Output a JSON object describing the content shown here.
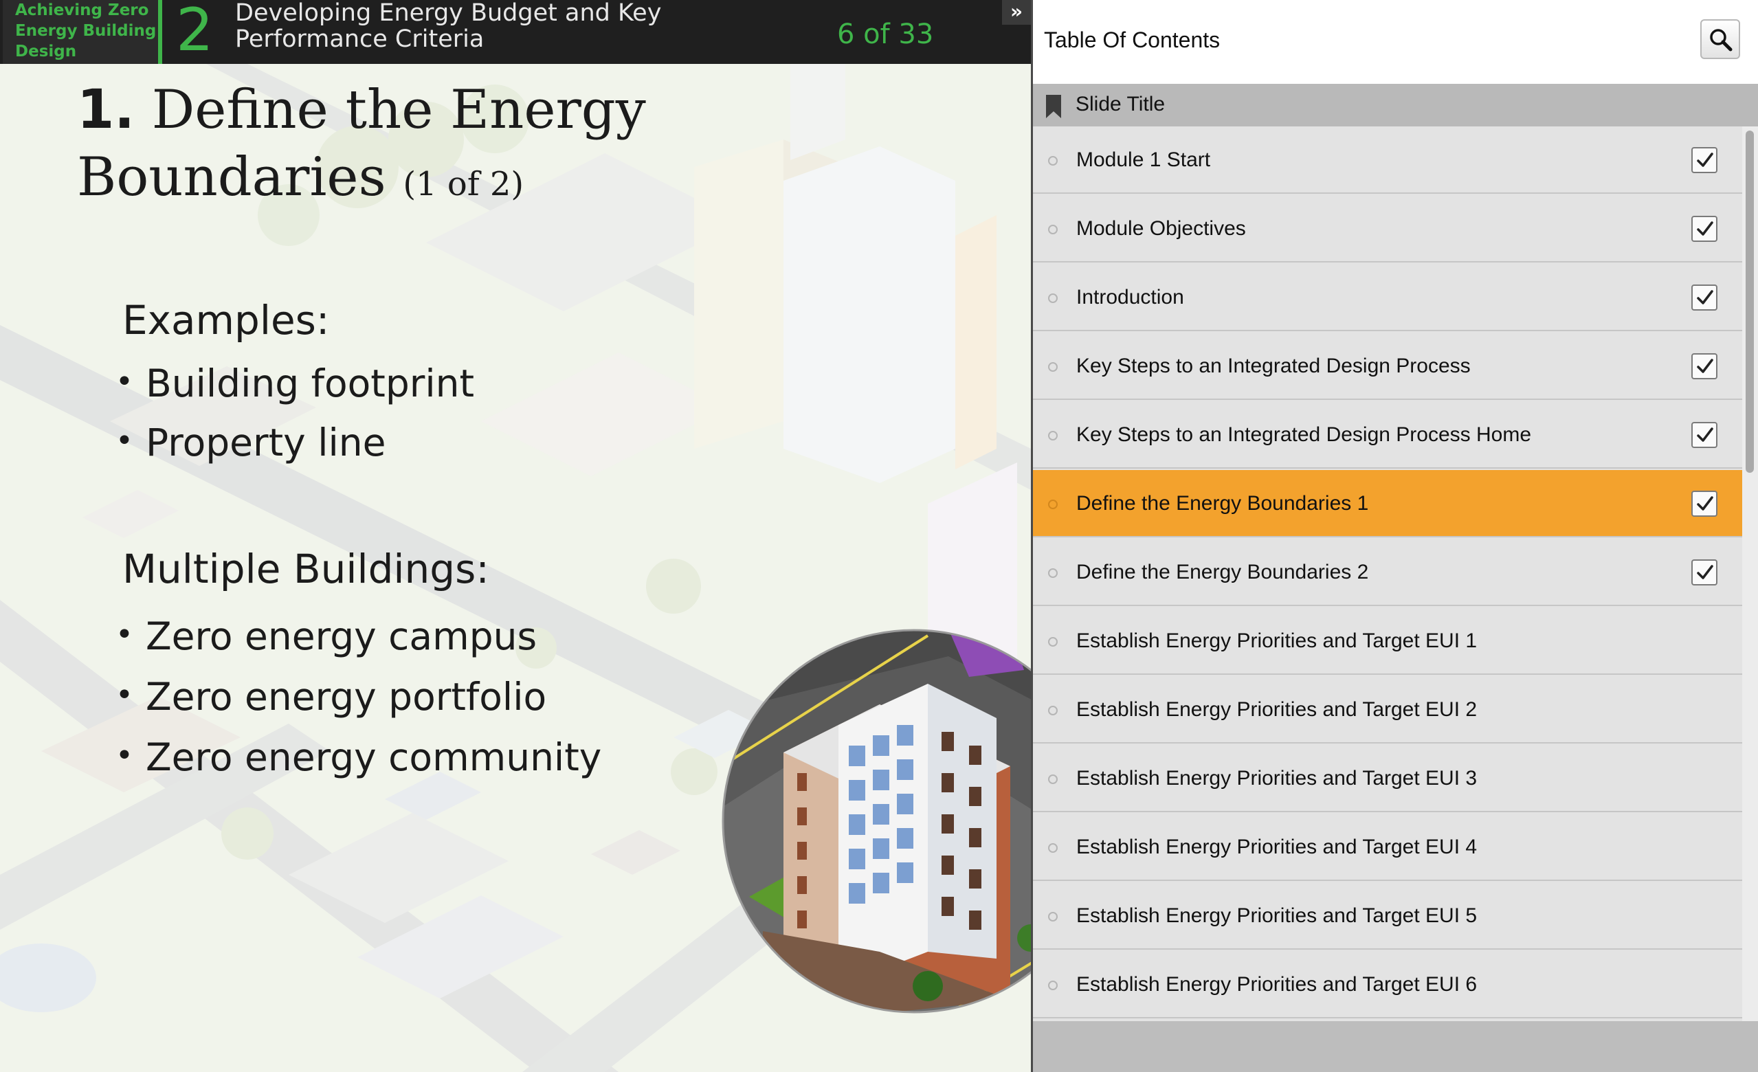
{
  "header": {
    "course_title_lines": [
      "Achieving Zero",
      "Energy Building",
      "Design"
    ],
    "module_number": "2",
    "module_name_lines": [
      "Developing Energy Budget and Key",
      "Performance Criteria"
    ],
    "slide_counter": "6 of 33",
    "collapse_icon": "double-chevron-right-icon"
  },
  "slide": {
    "title_num": "1.",
    "title_line1": "Define the Energy",
    "title_line2": "Boundaries",
    "title_sub": "(1 of 2)",
    "examples_heading": "Examples:",
    "examples": [
      "Building footprint",
      "Property line"
    ],
    "multi_heading": "Multiple Buildings:",
    "multi": [
      "Zero energy campus",
      "Zero energy portfolio",
      "Zero energy community"
    ]
  },
  "toc": {
    "title": "Table Of Contents",
    "search_icon": "magnifier-icon",
    "column_header": "Slide Title",
    "items": [
      {
        "label": "Module 1 Start",
        "checked": true
      },
      {
        "label": "Module Objectives",
        "checked": true
      },
      {
        "label": "Introduction",
        "checked": true
      },
      {
        "label": "Key Steps to an Integrated Design Process",
        "checked": true
      },
      {
        "label": "Key Steps to an Integrated Design Process Home",
        "checked": true
      },
      {
        "label": "Define the Energy Boundaries 1",
        "checked": true,
        "active": true
      },
      {
        "label": "Define the Energy Boundaries 2",
        "checked": true
      },
      {
        "label": "Establish Energy Priorities and Target EUI 1",
        "checked": false
      },
      {
        "label": "Establish Energy Priorities and Target EUI 2",
        "checked": false
      },
      {
        "label": "Establish Energy Priorities and Target EUI 3",
        "checked": false
      },
      {
        "label": "Establish Energy Priorities and Target EUI 4",
        "checked": false
      },
      {
        "label": "Establish Energy Priorities and Target EUI 5",
        "checked": false
      },
      {
        "label": "Establish Energy Priorities and Target EUI 6",
        "checked": false
      }
    ]
  },
  "colors": {
    "accent_green": "#3fb54a",
    "active_row": "#f3a22d"
  }
}
